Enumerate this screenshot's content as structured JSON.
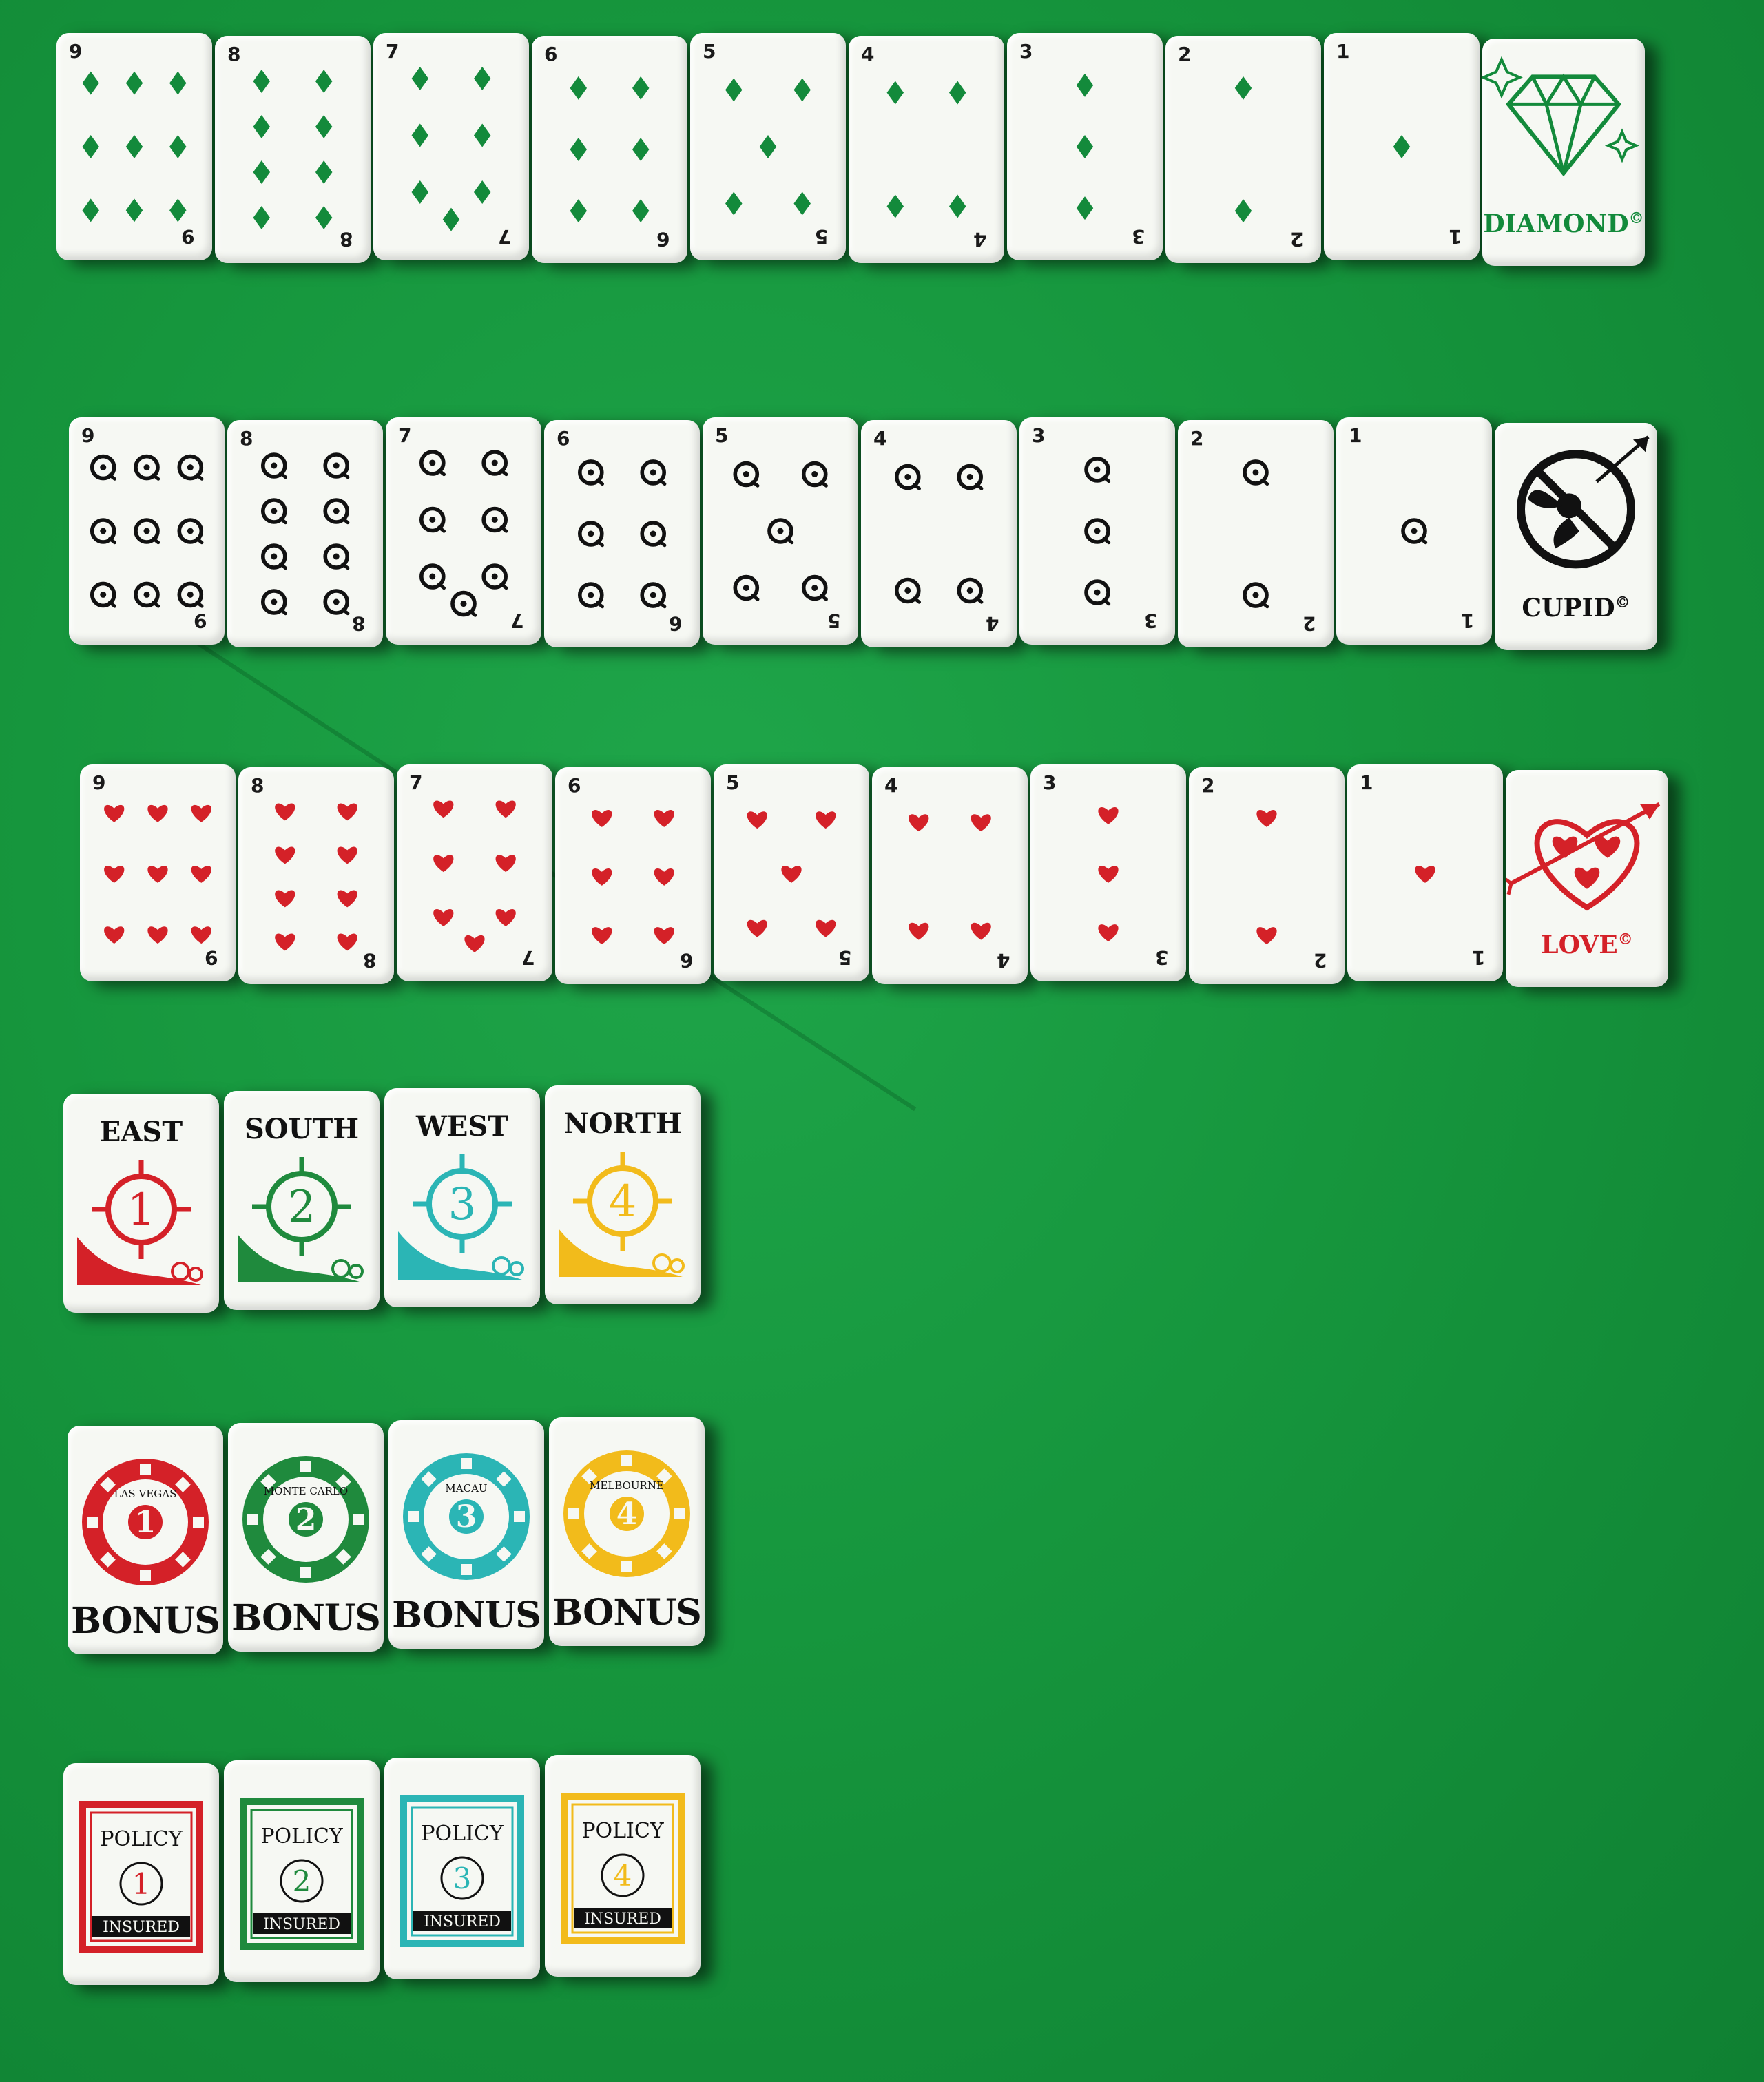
{
  "colors": {
    "felt": "#16963d",
    "tile": "#f6f8f3",
    "diamond": "#138a3b",
    "cupid": "#111111",
    "heart": "#d42128",
    "east": "#d42128",
    "south": "#1f8a3d",
    "west": "#2bb5b5",
    "north": "#f2bb1b"
  },
  "rows": {
    "diamonds": {
      "ranks": [
        "9",
        "8",
        "7",
        "6",
        "5",
        "4",
        "3",
        "2",
        "1"
      ],
      "honor_label": "DIAMOND",
      "copyright": "©",
      "icon": "diamond-gem-icon"
    },
    "cupids": {
      "ranks": [
        "9",
        "8",
        "7",
        "6",
        "5",
        "4",
        "3",
        "2",
        "1"
      ],
      "honor_label": "CUPID",
      "copyright": "©",
      "icon": "no-cupid-icon"
    },
    "hearts": {
      "ranks": [
        "9",
        "8",
        "7",
        "6",
        "5",
        "4",
        "3",
        "2",
        "1"
      ],
      "honor_label": "LOVE",
      "copyright": "©",
      "icon": "heart-arrow-icon"
    }
  },
  "winds": [
    {
      "name": "EAST",
      "number": "1"
    },
    {
      "name": "SOUTH",
      "number": "2"
    },
    {
      "name": "WEST",
      "number": "3"
    },
    {
      "name": "NORTH",
      "number": "4"
    }
  ],
  "bonus": [
    {
      "number": "1",
      "city": "LAS VEGAS",
      "label": "BONUS"
    },
    {
      "number": "2",
      "city": "MONTE CARLO",
      "label": "BONUS"
    },
    {
      "number": "3",
      "city": "MACAU",
      "label": "BONUS"
    },
    {
      "number": "4",
      "city": "MELBOURNE",
      "label": "BONUS"
    }
  ],
  "policy": [
    {
      "number": "1",
      "title": "POLICY",
      "footer": "INSURED"
    },
    {
      "number": "2",
      "title": "POLICY",
      "footer": "INSURED"
    },
    {
      "number": "3",
      "title": "POLICY",
      "footer": "INSURED"
    },
    {
      "number": "4",
      "title": "POLICY",
      "footer": "INSURED"
    }
  ]
}
